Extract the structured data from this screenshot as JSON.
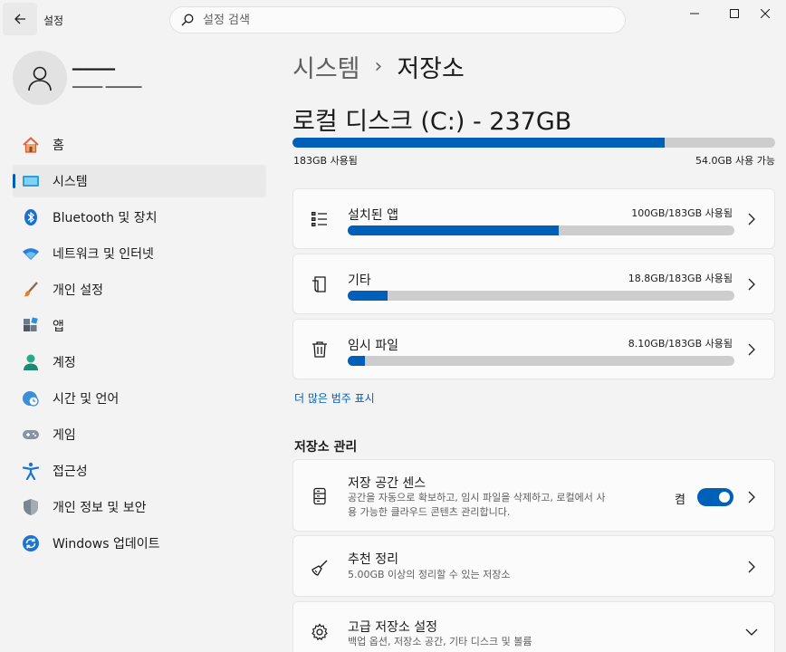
{
  "app": {
    "title": "설정",
    "search_placeholder": "설정 검색"
  },
  "profile": {
    "name": "━━━━━━",
    "email": "━━━━━  ━━━━━━"
  },
  "sidebar": {
    "items": [
      {
        "label": "홈",
        "icon": "home-icon",
        "active": false
      },
      {
        "label": "시스템",
        "icon": "system-icon",
        "active": true
      },
      {
        "label": "Bluetooth 및 장치",
        "icon": "bluetooth-icon",
        "active": false
      },
      {
        "label": "네트워크 및 인터넷",
        "icon": "wifi-icon",
        "active": false
      },
      {
        "label": "개인 설정",
        "icon": "brush-icon",
        "active": false
      },
      {
        "label": "앱",
        "icon": "apps-icon",
        "active": false
      },
      {
        "label": "계정",
        "icon": "account-icon",
        "active": false
      },
      {
        "label": "시간 및 언어",
        "icon": "clock-globe-icon",
        "active": false
      },
      {
        "label": "게임",
        "icon": "gamepad-icon",
        "active": false
      },
      {
        "label": "접근성",
        "icon": "accessibility-icon",
        "active": false
      },
      {
        "label": "개인 정보 및 보안",
        "icon": "shield-icon",
        "active": false
      },
      {
        "label": "Windows 업데이트",
        "icon": "update-icon",
        "active": false
      }
    ]
  },
  "breadcrumb": {
    "parent": "시스템",
    "separator": "›",
    "current": "저장소"
  },
  "drive": {
    "title": "로컬 디스크 (C:) - 237GB",
    "used_label": "183GB 사용됨",
    "free_label": "54.0GB 사용 가능",
    "used_fraction": 0.772
  },
  "categories": [
    {
      "title": "설치된 앱",
      "amount": "100GB/183GB 사용됨",
      "fraction": 0.546,
      "icon": "list-icon"
    },
    {
      "title": "기타",
      "amount": "18.8GB/183GB 사용됨",
      "fraction": 0.103,
      "icon": "document-icon"
    },
    {
      "title": "임시 파일",
      "amount": "8.10GB/183GB 사용됨",
      "fraction": 0.044,
      "icon": "trash-icon"
    }
  ],
  "more_link": "더 많은 범주 표시",
  "management": {
    "title": "저장소 관리",
    "storage_sense": {
      "title": "저장 공간 센스",
      "desc_line1": "공간을 자동으로 확보하고, 임시 파일을 삭제하고, 로컬에서 사",
      "desc_line2": "용 가능한 클라우드 콘텐츠 관리합니다.",
      "toggle_label": "켬",
      "toggle_on": true
    },
    "cleanup": {
      "title": "추천 정리",
      "desc": "5.00GB 이상의 정리할 수 있는 저장소"
    },
    "advanced": {
      "title": "고급 저장소 설정",
      "desc": "백업 옵션, 저장소 공간, 기타 디스크 및 볼륨"
    }
  },
  "colors": {
    "accent": "#005fb8",
    "bar_track": "#cdcdcd",
    "background": "#f3f3f3",
    "card": "#fbfbfb"
  }
}
